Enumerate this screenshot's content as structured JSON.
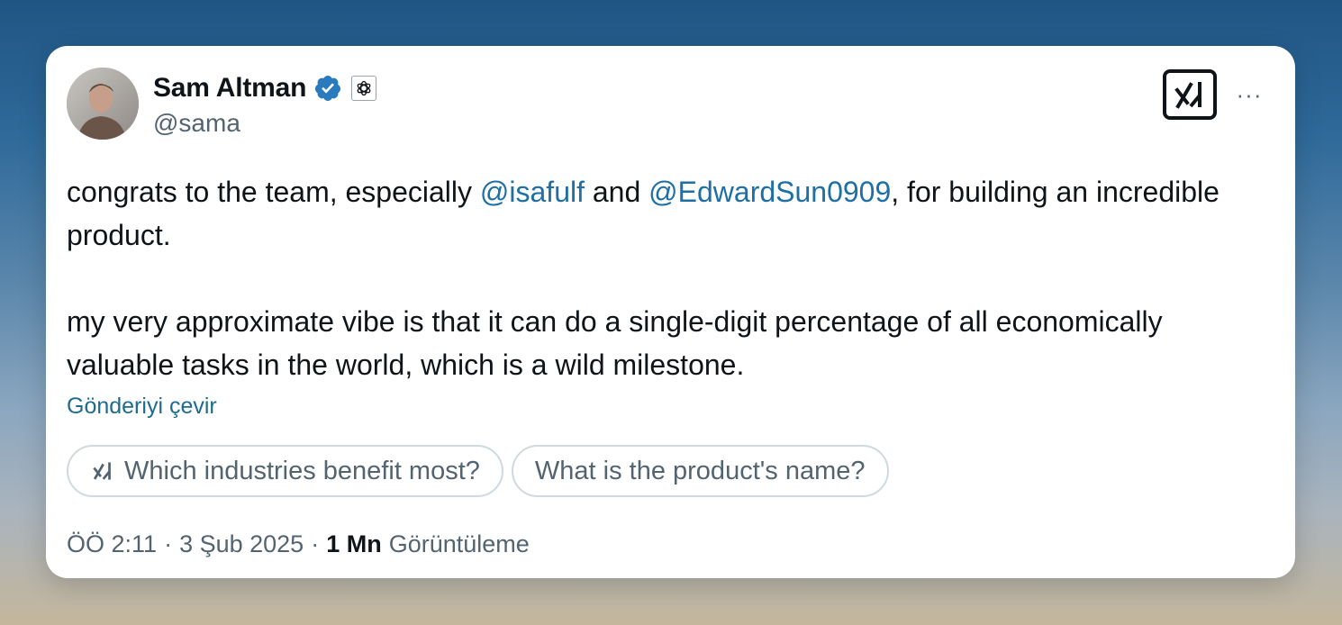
{
  "author": {
    "name": "Sam Altman",
    "handle": "@sama",
    "verified_color": "#2a7bbd"
  },
  "tweet": {
    "p1_before": "congrats to the team, especially ",
    "mention1": "@isafulf",
    "p1_mid": " and ",
    "mention2": "@EdwardSun0909",
    "p1_after": ", for building an incredible product.",
    "p2": "my very approximate vibe is that it can do a single-digit percentage of all economically valuable tasks in the world, which is a wild milestone."
  },
  "translate_label": "Gönderiyi çevir",
  "suggestions": [
    "Which industries benefit most?",
    "What is the product's name?"
  ],
  "meta": {
    "time": "ÖÖ 2:11",
    "date": "3 Şub 2025",
    "views_count": "1 Mn",
    "views_label": "Görüntüleme",
    "separator": "·"
  },
  "more_label": "···",
  "icons": {
    "verified": "verified-badge-icon",
    "affiliate": "openai-affiliate-icon",
    "grok": "grok-logo-icon",
    "more": "more-options-icon"
  }
}
